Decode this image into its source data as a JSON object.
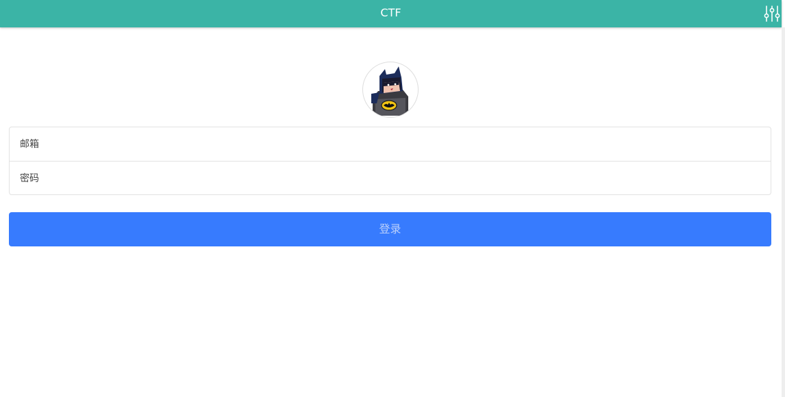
{
  "header": {
    "title": "CTF",
    "settings_icon": "sliders-icon",
    "bar_color": "#3bb4a6"
  },
  "avatar": {
    "icon": "batman-avatar"
  },
  "form": {
    "email_placeholder": "邮箱",
    "password_placeholder": "密码",
    "email_value": "",
    "password_value": ""
  },
  "actions": {
    "login_label": "登录",
    "login_color": "#377bfe"
  }
}
